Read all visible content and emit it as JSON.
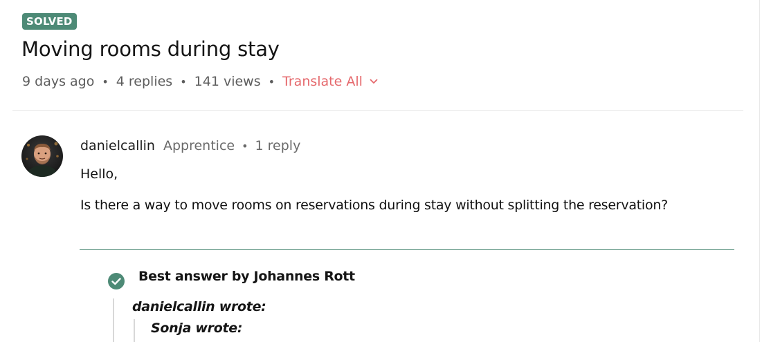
{
  "thread": {
    "status_badge": "SOLVED",
    "title": "Moving rooms during stay",
    "meta": {
      "age": "9 days ago",
      "replies": "4 replies",
      "views": "141 views",
      "translate_label": "Translate All"
    }
  },
  "post": {
    "author": "danielcallin",
    "rank": "Apprentice",
    "reply_count": "1 reply",
    "body_line1": "Hello,",
    "body_line2": "Is there a way to move rooms on reservations during stay without splitting the reservation?"
  },
  "best_answer": {
    "label": "Best answer by Johannes Rott",
    "quote_author": "danielcallin wrote:",
    "nested_quote_author": "Sonja wrote:"
  },
  "colors": {
    "accent_green": "#4d8a76",
    "translate_red": "#e5686c"
  },
  "icons": [
    "chevron-down-icon",
    "check-circle-icon",
    "avatar"
  ]
}
